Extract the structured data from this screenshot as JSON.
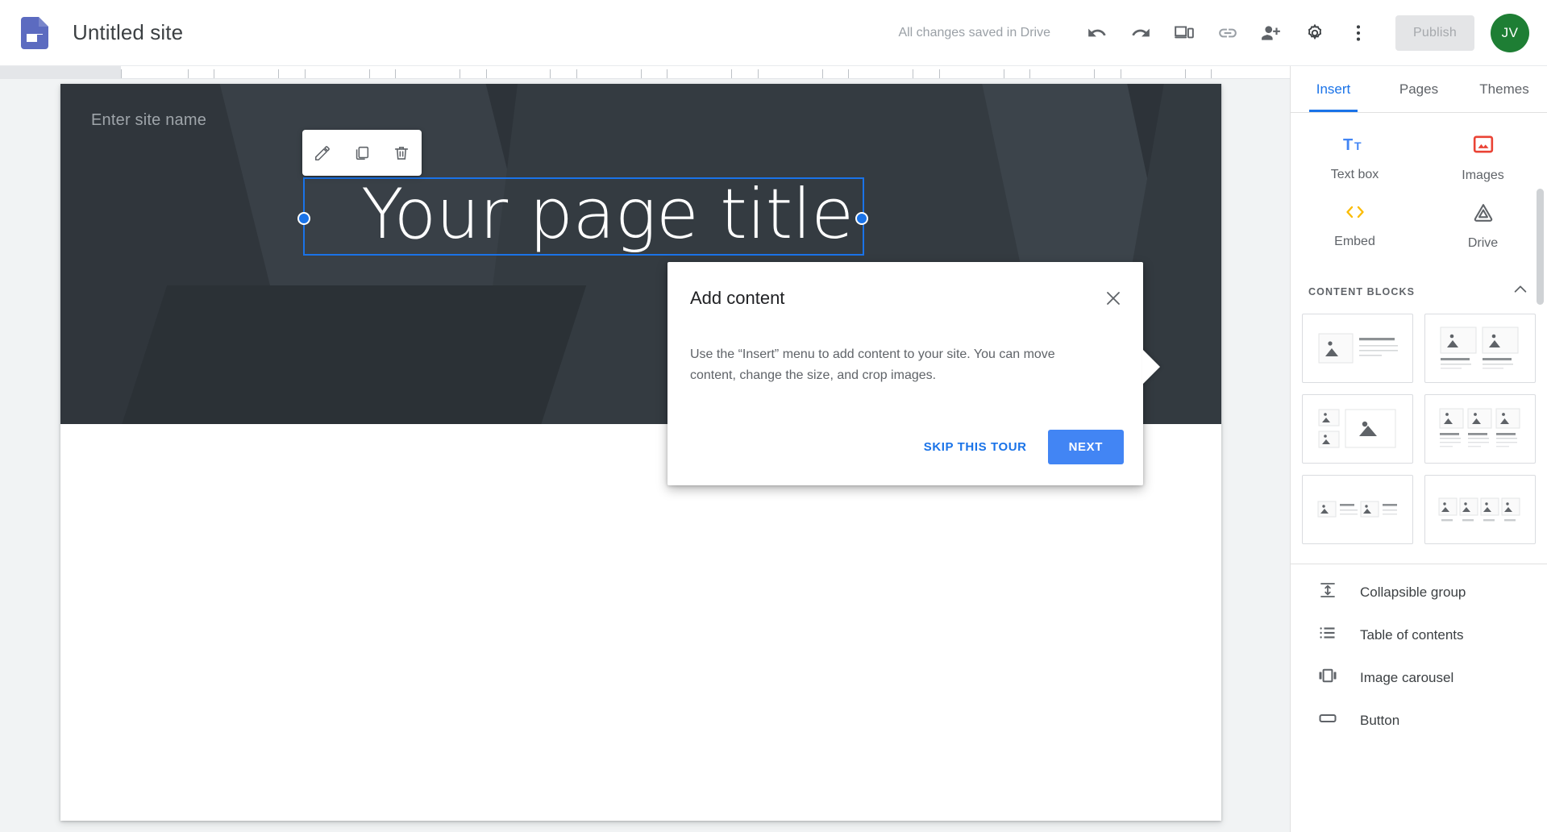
{
  "app": {
    "logo_icon": "google-sites-icon",
    "title": "Untitled site",
    "save_status": "All changes saved in Drive",
    "publish_label": "Publish",
    "avatar_initials": "JV",
    "avatar_color": "#1e7e34",
    "accent_color": "#1a73e8",
    "toolbar_icons": [
      {
        "name": "undo-icon",
        "label": "Undo"
      },
      {
        "name": "redo-icon",
        "label": "Redo"
      },
      {
        "name": "preview-icon",
        "label": "Preview"
      },
      {
        "name": "copy-link-icon",
        "label": "Copy published site link"
      },
      {
        "name": "add-editor-icon",
        "label": "Share with others"
      },
      {
        "name": "settings-gear-icon",
        "label": "Settings"
      },
      {
        "name": "more-vert-icon",
        "label": "More"
      }
    ]
  },
  "canvas": {
    "site_name_placeholder": "Enter site name",
    "page_title": "Your page title",
    "banner_color": "#2d3339",
    "element_toolbar": [
      {
        "name": "edit-pencil-icon",
        "label": "Edit"
      },
      {
        "name": "duplicate-icon",
        "label": "Duplicate"
      },
      {
        "name": "delete-trash-icon",
        "label": "Delete"
      }
    ]
  },
  "tour": {
    "title": "Add content",
    "body": "Use the “Insert” menu to add content to your site. You can move content, change the size, and crop images.",
    "skip_label": "SKIP THIS TOUR",
    "next_label": "NEXT",
    "close_icon": "close-icon"
  },
  "sidebar": {
    "tabs": [
      {
        "label": "Insert",
        "active": true
      },
      {
        "label": "Pages",
        "active": false
      },
      {
        "label": "Themes",
        "active": false
      }
    ],
    "insert_items": [
      {
        "label": "Text box",
        "icon": "text-box-icon",
        "color": "#4285f4"
      },
      {
        "label": "Images",
        "icon": "images-icon",
        "color": "#ea4335"
      },
      {
        "label": "Embed",
        "icon": "embed-code-icon",
        "color": "#fbbc04"
      },
      {
        "label": "Drive",
        "icon": "google-drive-icon",
        "color": "#5f6368"
      }
    ],
    "content_blocks": {
      "title": "CONTENT BLOCKS",
      "collapse_icon": "chevron-up-icon",
      "layouts": [
        "image-left-text-right",
        "two-images-with-captions",
        "two-small-images-one-large",
        "three-images-with-captions",
        "two-image-text-pairs",
        "four-images-row"
      ]
    },
    "components": [
      {
        "label": "Collapsible group",
        "icon": "collapsible-group-icon"
      },
      {
        "label": "Table of contents",
        "icon": "table-of-contents-icon"
      },
      {
        "label": "Image carousel",
        "icon": "image-carousel-icon"
      },
      {
        "label": "Button",
        "icon": "button-icon"
      }
    ]
  }
}
